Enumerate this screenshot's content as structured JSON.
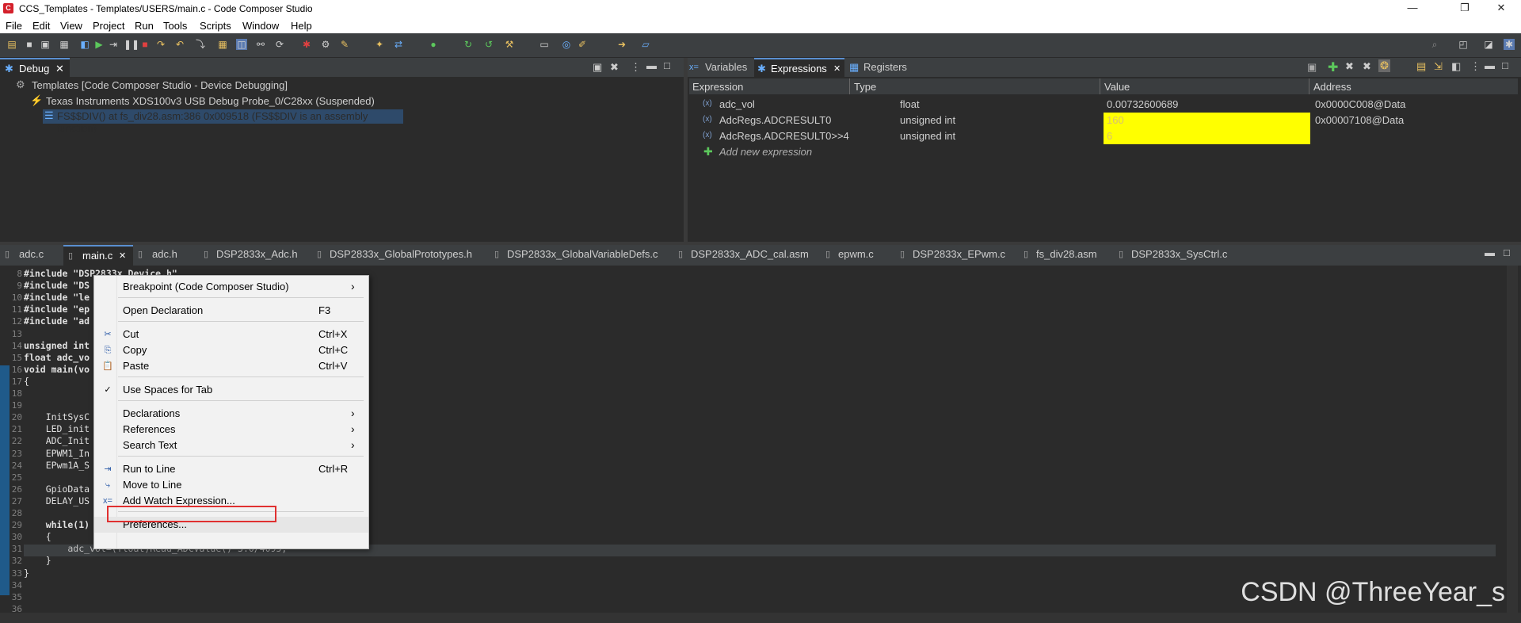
{
  "window": {
    "title": "CCS_Templates - Templates/USERS/main.c - Code Composer Studio",
    "icon_letter": "C",
    "minimize": "—",
    "maximize": "❐",
    "close": "✕"
  },
  "menu": [
    "File",
    "Edit",
    "View",
    "Project",
    "Run",
    "Tools",
    "Scripts",
    "Window",
    "Help"
  ],
  "debug_view": {
    "tab": "Debug",
    "items": [
      "Templates [Code Composer Studio - Device Debugging]",
      "Texas Instruments XDS100v3 USB Debug Probe_0/C28xx (Suspended)",
      "FS$$DIV() at fs_div28.asm:386 0x009518  (FS$$DIV is an assembly function)"
    ]
  },
  "expressions_view": {
    "tabs": [
      "Variables",
      "Expressions",
      "Registers"
    ],
    "columns": [
      "Expression",
      "Type",
      "Value",
      "Address"
    ],
    "rows": [
      {
        "expression": "adc_vol",
        "type": "float",
        "value": "0.00732600689",
        "address": "0x0000C008@Data"
      },
      {
        "expression": "AdcRegs.ADCRESULT0",
        "type": "unsigned int",
        "value": "160",
        "address": "0x00007108@Data"
      },
      {
        "expression": "AdcRegs.ADCRESULT0>>4",
        "type": "unsigned int",
        "value": "6",
        "address": ""
      }
    ],
    "add_new": "Add new expression",
    "highlight_color": "#ffff00"
  },
  "editor": {
    "tabs": [
      "adc.c",
      "main.c",
      "adc.h",
      "DSP2833x_Adc.h",
      "DSP2833x_GlobalPrototypes.h",
      "DSP2833x_GlobalVariableDefs.c",
      "DSP2833x_ADC_cal.asm",
      "epwm.c",
      "DSP2833x_EPwm.c",
      "fs_div28.asm",
      "DSP2833x_SysCtrl.c"
    ],
    "active_tab": "main.c",
    "lines": [
      {
        "n": "8",
        "text": "#include \"DSP2833x_Device.h\""
      },
      {
        "n": "9",
        "text": "#include \"DS"
      },
      {
        "n": "10",
        "text": "#include \"le"
      },
      {
        "n": "11",
        "text": "#include \"ep"
      },
      {
        "n": "12",
        "text": "#include \"ad"
      },
      {
        "n": "13",
        "text": ""
      },
      {
        "n": "14",
        "text": "unsigned int"
      },
      {
        "n": "15",
        "text": "float adc_vo"
      },
      {
        "n": "16",
        "text": "void main(vo"
      },
      {
        "n": "17",
        "text": "{"
      },
      {
        "n": "18",
        "text": ""
      },
      {
        "n": "19",
        "text": ""
      },
      {
        "n": "20",
        "text": "    InitSysC"
      },
      {
        "n": "21",
        "text": "    LED_init"
      },
      {
        "n": "22",
        "text": "    ADC_Init"
      },
      {
        "n": "23",
        "text": "    EPWM1_In"
      },
      {
        "n": "24",
        "text": "    EPwm1A_S"
      },
      {
        "n": "25",
        "text": ""
      },
      {
        "n": "26",
        "text": "    GpioData"
      },
      {
        "n": "27",
        "text": "    DELAY_US"
      },
      {
        "n": "28",
        "text": ""
      },
      {
        "n": "29",
        "text": "    while(1)"
      },
      {
        "n": "30",
        "text": "    {"
      },
      {
        "n": "31",
        "text": "        adc_vol=(float)Read_ADCValue()*3.0/4095;"
      },
      {
        "n": "32",
        "text": "    }"
      },
      {
        "n": "33",
        "text": "}"
      },
      {
        "n": "34",
        "text": ""
      },
      {
        "n": "35",
        "text": ""
      },
      {
        "n": "36",
        "text": ""
      }
    ]
  },
  "context_menu": {
    "items": [
      {
        "label": "Breakpoint (Code Composer Studio)",
        "shortcut": "",
        "submenu": true,
        "icon": ""
      },
      {
        "label": "Open Declaration",
        "shortcut": "F3",
        "submenu": false,
        "icon": ""
      },
      {
        "label": "Cut",
        "shortcut": "Ctrl+X",
        "submenu": false,
        "icon": "scissors-icon"
      },
      {
        "label": "Copy",
        "shortcut": "Ctrl+C",
        "submenu": false,
        "icon": "copy-icon"
      },
      {
        "label": "Paste",
        "shortcut": "Ctrl+V",
        "submenu": false,
        "icon": "paste-icon"
      },
      {
        "label": "Use Spaces for Tab",
        "shortcut": "",
        "submenu": false,
        "icon": "checkmark-icon"
      },
      {
        "label": "Declarations",
        "shortcut": "",
        "submenu": true,
        "icon": ""
      },
      {
        "label": "References",
        "shortcut": "",
        "submenu": true,
        "icon": ""
      },
      {
        "label": "Search Text",
        "shortcut": "",
        "submenu": true,
        "icon": ""
      },
      {
        "label": "Run to Line",
        "shortcut": "Ctrl+R",
        "submenu": false,
        "icon": "run-to-line-icon"
      },
      {
        "label": "Move to Line",
        "shortcut": "",
        "submenu": false,
        "icon": "move-to-line-icon"
      },
      {
        "label": "Add Watch Expression...",
        "shortcut": "",
        "submenu": false,
        "icon": "watch-expression-icon"
      },
      {
        "label": "Preferences...",
        "shortcut": "",
        "submenu": false,
        "icon": ""
      }
    ],
    "highlight_color": "#e03030"
  },
  "watermark": "CSDN @ThreeYear_s"
}
